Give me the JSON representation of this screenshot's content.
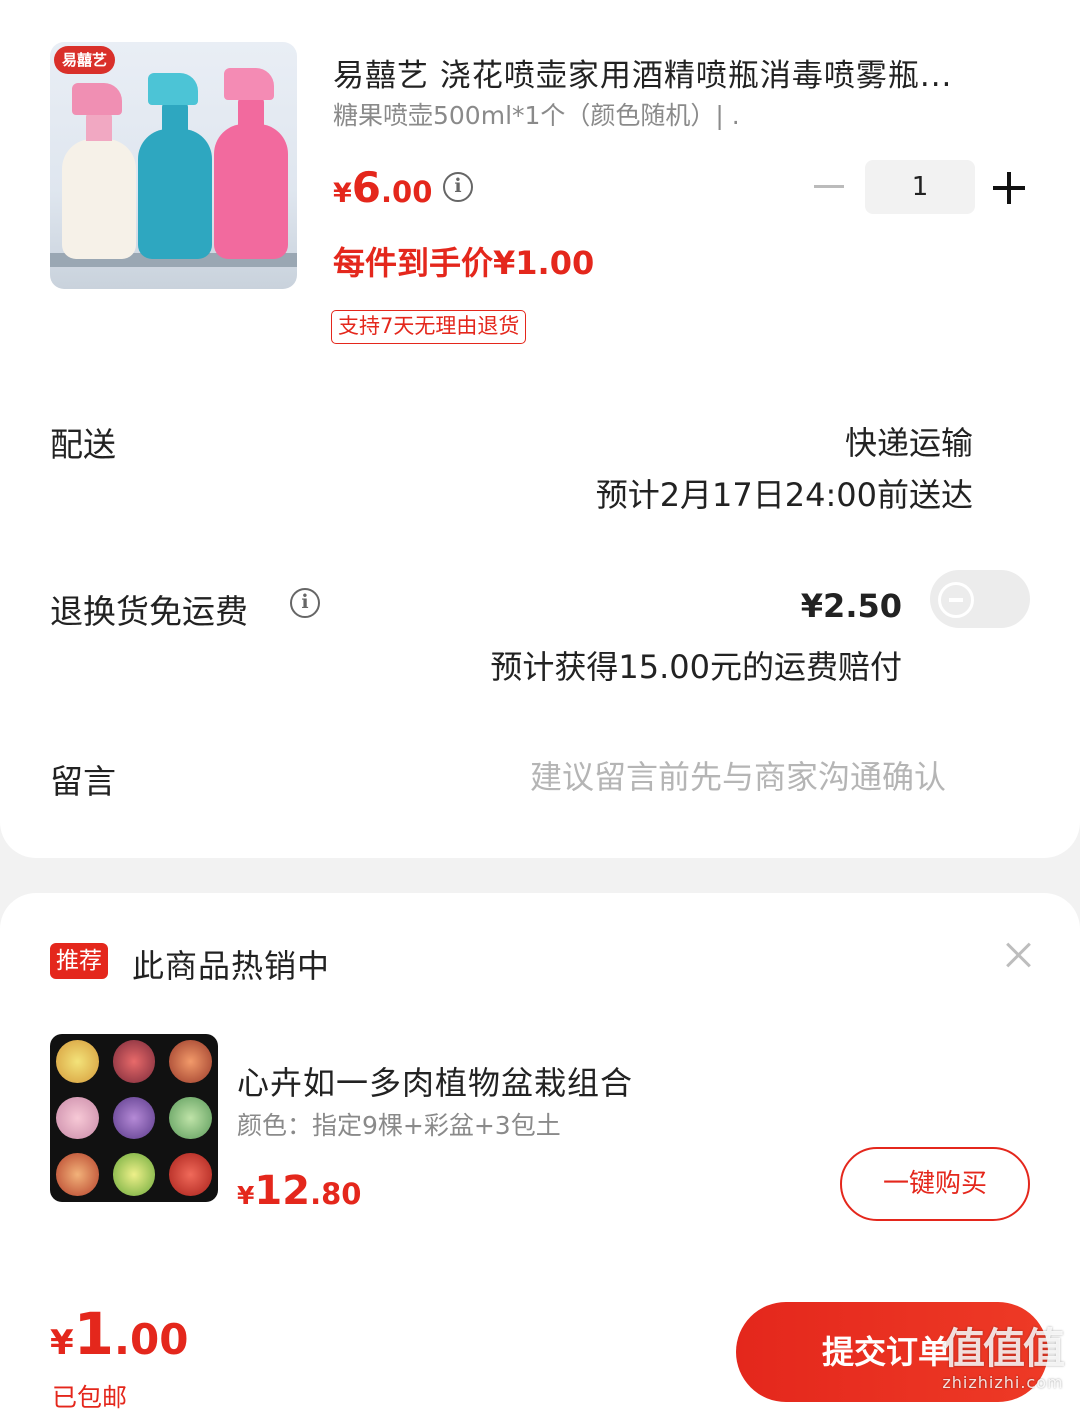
{
  "product": {
    "brand_badge": "易囍艺",
    "title": "易囍艺 浇花喷壶家用酒精喷瓶消毒喷雾瓶...",
    "spec": "糖果喷壶500ml*1个（颜色随机）| .",
    "price": {
      "symbol": "¥",
      "integer": "6",
      "decimal": ".00"
    },
    "quantity": "1",
    "final_price_label": "每件到手价¥1.00",
    "return_badge": "支持7天无理由退货"
  },
  "delivery": {
    "label": "配送",
    "method": "快递运输",
    "eta": "预计2月17日24:00前送达"
  },
  "return_shipping": {
    "label": "退换货免运费",
    "price": "¥2.50",
    "note": "预计获得15.00元的运费赔付",
    "enabled": false
  },
  "message": {
    "label": "留言",
    "placeholder": "建议留言前先与商家沟通确认"
  },
  "recommend": {
    "tag": "推荐",
    "title": "此商品热销中",
    "item": {
      "name": "心卉如一多肉植物盆栽组合",
      "spec": "颜色：指定9棵+彩盆+3包土",
      "price": {
        "symbol": "¥",
        "integer": "12",
        "decimal": ".80"
      },
      "button": "一键购买"
    }
  },
  "footer": {
    "total": {
      "symbol": "¥",
      "integer": "1",
      "decimal": ".00"
    },
    "shipping_note": "已包邮",
    "submit_label": "提交订单"
  },
  "watermark": {
    "main": "值值值",
    "sub": "zhizhizhi.com"
  },
  "colors": {
    "accent": "#e4271c",
    "text_primary": "#222222",
    "text_secondary": "#8a8a8a",
    "placeholder": "#b5b5b5",
    "background": "#f2f2f2"
  }
}
